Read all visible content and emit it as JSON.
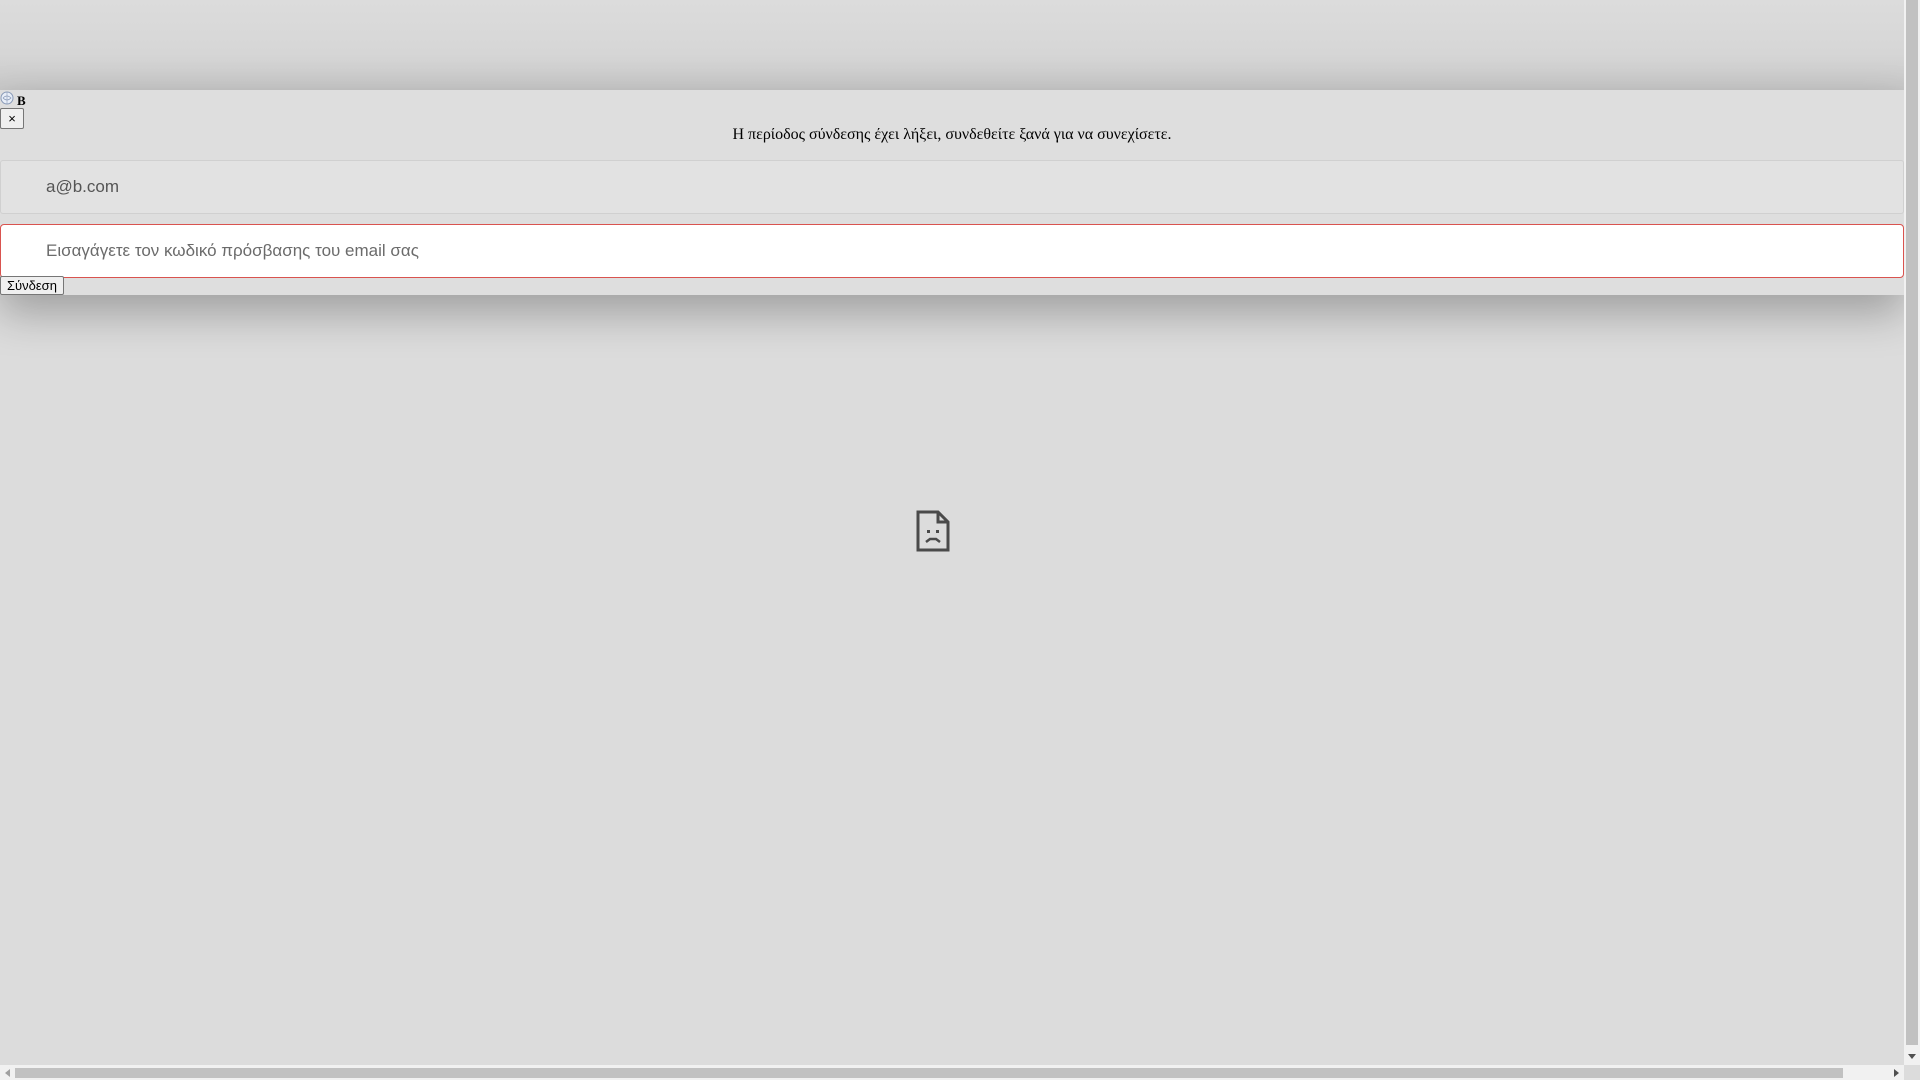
{
  "header": {
    "brand_letter": "B",
    "logo_icon": "globe-logo-icon"
  },
  "modal": {
    "close_label": "×",
    "message": "Η περίοδος σύνδεσης έχει λήξει, συνδεθείτε ξανά για να συνεχίσετε.",
    "email_value": "a@b.com",
    "password_placeholder": "Εισαγάγετε τον κωδικό πρόσβασης του email σας",
    "login_label": "Σύνδεση"
  },
  "content": {
    "image_icon": "broken-image-icon"
  },
  "colors": {
    "error_border": "#d9534f",
    "background": "#dcdcdc"
  }
}
